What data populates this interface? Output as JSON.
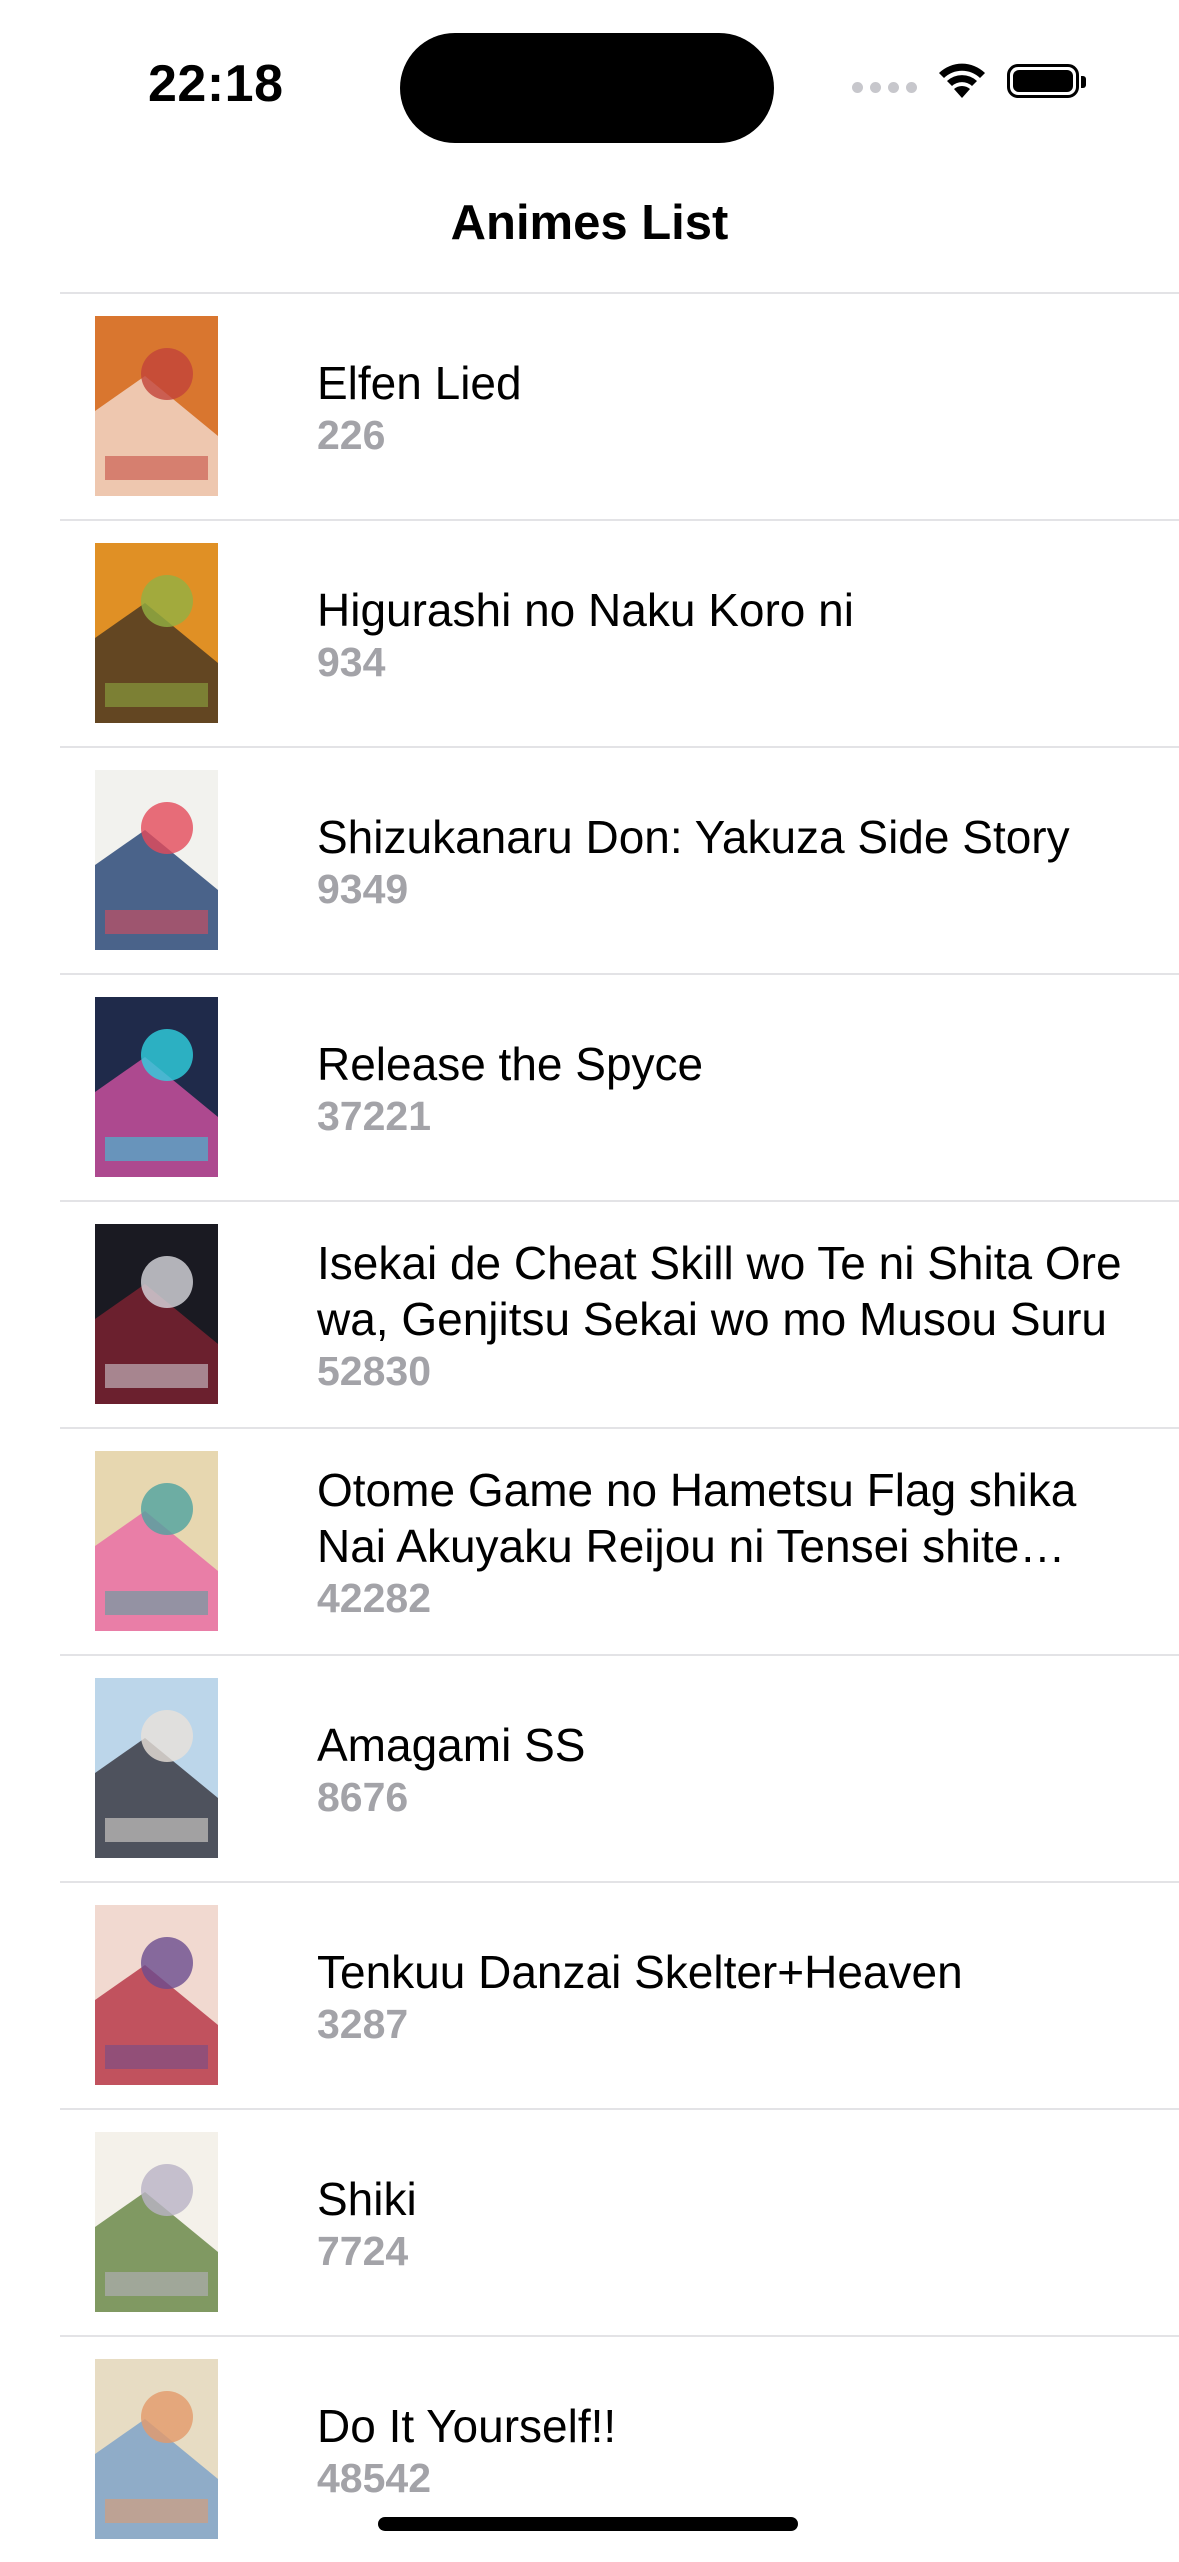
{
  "status_bar": {
    "time": "22:18",
    "icons": [
      "signal-icon",
      "wifi-icon",
      "battery-icon"
    ]
  },
  "nav": {
    "title": "Animes List"
  },
  "items": [
    {
      "title": "Elfen Lied",
      "subtitle": "226",
      "poster_colors": [
        "#d9762f",
        "#f1d6c6",
        "#c2433a"
      ]
    },
    {
      "title": "Higurashi no Naku Koro ni",
      "subtitle": "934",
      "poster_colors": [
        "#e09025",
        "#4c3a22",
        "#92b043"
      ]
    },
    {
      "title": "Shizukanaru Don: Yakuza Side Story",
      "subtitle": "9349",
      "poster_colors": [
        "#f2f2ee",
        "#2d4a78",
        "#e34a5a"
      ]
    },
    {
      "title": "Release the Spyce",
      "subtitle": "37221",
      "poster_colors": [
        "#1f2a4a",
        "#c74f9b",
        "#2fd2e0"
      ]
    },
    {
      "title": "Isekai de Cheat Skill wo Te ni Shita Ore wa, Genjitsu Sekai wo mo Musou Suru",
      "subtitle": "52830",
      "poster_colors": [
        "#1a1a22",
        "#7a2230",
        "#d9d9e0"
      ]
    },
    {
      "title": "Otome Game no Hametsu Flag shika Nai Akuyaku Reijou ni Tensei shite shimatta...",
      "subtitle": "42282",
      "poster_colors": [
        "#e7d7b0",
        "#e96fa6",
        "#4fa3a0"
      ]
    },
    {
      "title": "Amagami SS",
      "subtitle": "8676",
      "poster_colors": [
        "#bcd6ea",
        "#3b3b44",
        "#e8e1da"
      ]
    },
    {
      "title": "Tenkuu Danzai Skelter+Heaven",
      "subtitle": "3287",
      "poster_colors": [
        "#f1d9d0",
        "#b83a4a",
        "#6b4c8e"
      ]
    },
    {
      "title": "Shiki",
      "subtitle": "7724",
      "poster_colors": [
        "#f4f1ea",
        "#6b8a4a",
        "#b9b3c6"
      ]
    },
    {
      "title": "Do It Yourself!!",
      "subtitle": "48542",
      "poster_colors": [
        "#e7dcc3",
        "#7fa3c9",
        "#e39a6a"
      ]
    }
  ]
}
